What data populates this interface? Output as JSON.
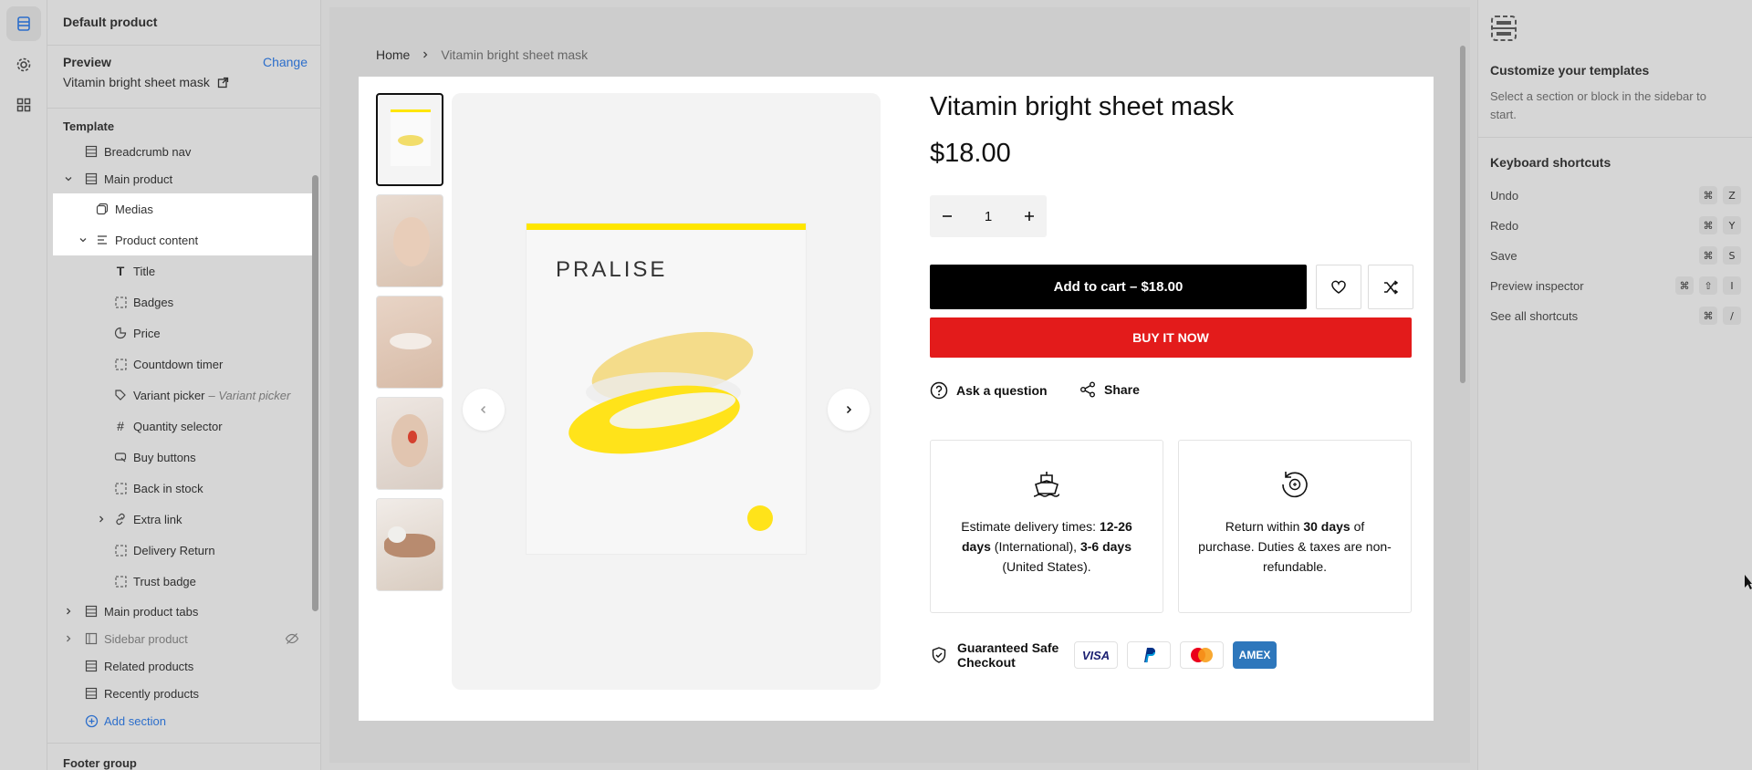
{
  "sidebar": {
    "title": "Default product",
    "preview_label": "Preview",
    "change_label": "Change",
    "preview_value": "Vitamin bright sheet mask",
    "template_label": "Template",
    "items": [
      {
        "label": "Breadcrumb nav"
      },
      {
        "label": "Main product"
      },
      {
        "label": "Medias"
      },
      {
        "label": "Product content"
      },
      {
        "label": "Title"
      },
      {
        "label": "Badges"
      },
      {
        "label": "Price"
      },
      {
        "label": "Countdown timer"
      },
      {
        "label": "Variant picker",
        "sub": "– Variant picker"
      },
      {
        "label": "Quantity selector"
      },
      {
        "label": "Buy buttons"
      },
      {
        "label": "Back in stock"
      },
      {
        "label": "Extra link"
      },
      {
        "label": "Delivery Return"
      },
      {
        "label": "Trust badge"
      },
      {
        "label": "Main product tabs"
      },
      {
        "label": "Sidebar product"
      },
      {
        "label": "Related products"
      },
      {
        "label": "Recently products"
      },
      {
        "label": "Add section"
      }
    ],
    "footer_group_label": "Footer group"
  },
  "breadcrumb": {
    "home": "Home",
    "current": "Vitamin bright sheet mask"
  },
  "product": {
    "title": "Vitamin bright sheet mask",
    "price": "$18.00",
    "quantity": "1",
    "add_to_cart": "Add to cart – $18.00",
    "buy_now": "BUY IT NOW",
    "ask_question": "Ask a question",
    "share": "Share",
    "pack_brand": "PRALISE",
    "delivery": {
      "pre": "Estimate delivery times: ",
      "intl_days": "12-26 days",
      "intl": " (International), ",
      "us_days": "3-6 days",
      "us": " (United States)."
    },
    "returns": {
      "pre": "Return within ",
      "days": "30 days",
      "post": " of purchase. Duties & taxes are non-refundable."
    },
    "safe_checkout": "Guaranteed Safe Checkout",
    "payments": [
      "VISA",
      "PayPal",
      "Mastercard",
      "AMEX"
    ],
    "accent_red": "#e31b1b",
    "mask_yellow": "#ffe600"
  },
  "right_panel": {
    "heading": "Customize your templates",
    "sub": "Select a section or block in the sidebar to start.",
    "shortcuts_title": "Keyboard shortcuts",
    "shortcuts": [
      {
        "label": "Undo",
        "keys": [
          "⌘",
          "Z"
        ]
      },
      {
        "label": "Redo",
        "keys": [
          "⌘",
          "Y"
        ]
      },
      {
        "label": "Save",
        "keys": [
          "⌘",
          "S"
        ]
      },
      {
        "label": "Preview inspector",
        "keys": [
          "⌘",
          "⇧",
          "I"
        ]
      },
      {
        "label": "See all shortcuts",
        "keys": [
          "⌘",
          "/"
        ]
      }
    ]
  }
}
